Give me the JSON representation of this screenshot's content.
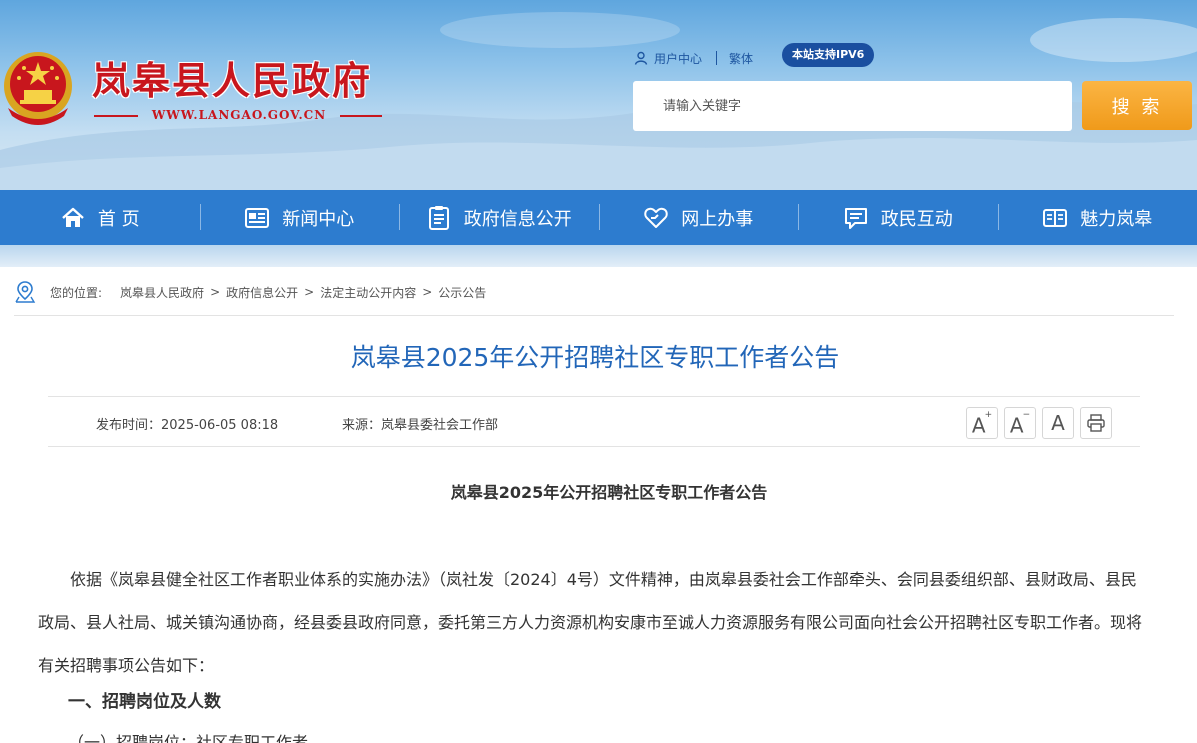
{
  "header": {
    "site_title": "岚皋县人民政府",
    "site_url": "WWW.LANGAO.GOV.CN",
    "user_center": "用户中心",
    "traditional": "繁体",
    "ipv6_badge": "本站支持IPV6",
    "search_placeholder": "请输入关键字",
    "search_button": "搜 索"
  },
  "nav": {
    "items": [
      {
        "label": "首 页",
        "icon": "home-icon"
      },
      {
        "label": "新闻中心",
        "icon": "news-icon"
      },
      {
        "label": "政府信息公开",
        "icon": "document-icon"
      },
      {
        "label": "网上办事",
        "icon": "heart-hand-icon"
      },
      {
        "label": "政民互动",
        "icon": "chat-icon"
      },
      {
        "label": "魅力岚皋",
        "icon": "book-icon"
      }
    ]
  },
  "breadcrumb": {
    "label": "您的位置:",
    "items": [
      "岚皋县人民政府",
      "政府信息公开",
      "法定主动公开内容",
      "公示公告"
    ]
  },
  "article": {
    "title": "岚皋县2025年公开招聘社区专职工作者公告",
    "publish_time": "发布时间：2025-06-05 08:18",
    "source": "来源：岚皋县委社会工作部",
    "tools": {
      "font_larger": "A",
      "font_smaller": "A",
      "font_default": "A",
      "plus": "+",
      "minus": "−"
    },
    "doc_title": "岚皋县2025年公开招聘社区专职工作者公告",
    "paragraph": "依据《岚皋县健全社区工作者职业体系的实施办法》（岚社发〔2024〕4号）文件精神，由岚皋县委社会工作部牵头、会同县委组织部、县财政局、县民政局、县人社局、城关镇沟通协商，经县委县政府同意，委托第三方人力资源机构安康市至诚人力资源服务有限公司面向社会公开招聘社区专职工作者。现将有关招聘事项公告如下：",
    "heading1": "一、招聘岗位及人数",
    "heading2": "（一）招聘岗位：社区专职工作者"
  },
  "colors": {
    "brand_red": "#c8161d",
    "nav_blue": "#2d7ccf",
    "title_blue": "#2266b8",
    "search_orange": "#f5a623",
    "ipv6_blue": "#1a4fa0"
  }
}
